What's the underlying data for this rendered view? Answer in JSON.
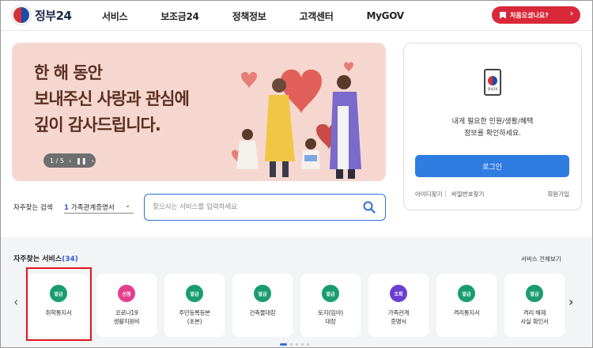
{
  "header": {
    "logo_text": "정부24",
    "nav": [
      "서비스",
      "보조금24",
      "정책정보",
      "고객센터",
      "MyGOV"
    ],
    "first_visit_label": "처음오셨나요?"
  },
  "banner": {
    "lines": [
      "한 해 동안",
      "보내주신 사랑과 관심에",
      "깊이 감사드립니다."
    ],
    "pager": "1 / 5"
  },
  "login": {
    "phone_label": "정부24",
    "desc_line1": "내게 필요한 민원/생활/혜택",
    "desc_line2": "정보를 확인하세요.",
    "button": "로그인",
    "find_id": "아이디찾기",
    "find_pw": "비밀번호찾기",
    "signup": "회원가입"
  },
  "search": {
    "label": "자주찾는 검색",
    "select_num": "1",
    "select_value": "가족관계증명서",
    "placeholder": "찾으시는 서비스를 입력하세요"
  },
  "services": {
    "title": "자주찾는 서비스",
    "count": "(34)",
    "view_all": "서비스 전체보기",
    "items": [
      {
        "badge": "발급",
        "color": "#1a9d6e",
        "line1": "취학통지서",
        "line2": ""
      },
      {
        "badge": "신청",
        "color": "#e43f8e",
        "line1": "코로나19",
        "line2": "생활지원비"
      },
      {
        "badge": "발급",
        "color": "#1a9d6e",
        "line1": "주민등록등본",
        "line2": "(초본)"
      },
      {
        "badge": "발급",
        "color": "#1a9d6e",
        "line1": "건축물대장",
        "line2": ""
      },
      {
        "badge": "발급",
        "color": "#1a9d6e",
        "line1": "토지(임야)",
        "line2": "대장"
      },
      {
        "badge": "조회",
        "color": "#6a3fd0",
        "line1": "가족관계",
        "line2": "증명서"
      },
      {
        "badge": "발급",
        "color": "#1a9d6e",
        "line1": "격리통지서",
        "line2": ""
      },
      {
        "badge": "발급",
        "color": "#1a9d6e",
        "line1": "격리 해제",
        "line2": "사실 확인서"
      }
    ]
  }
}
